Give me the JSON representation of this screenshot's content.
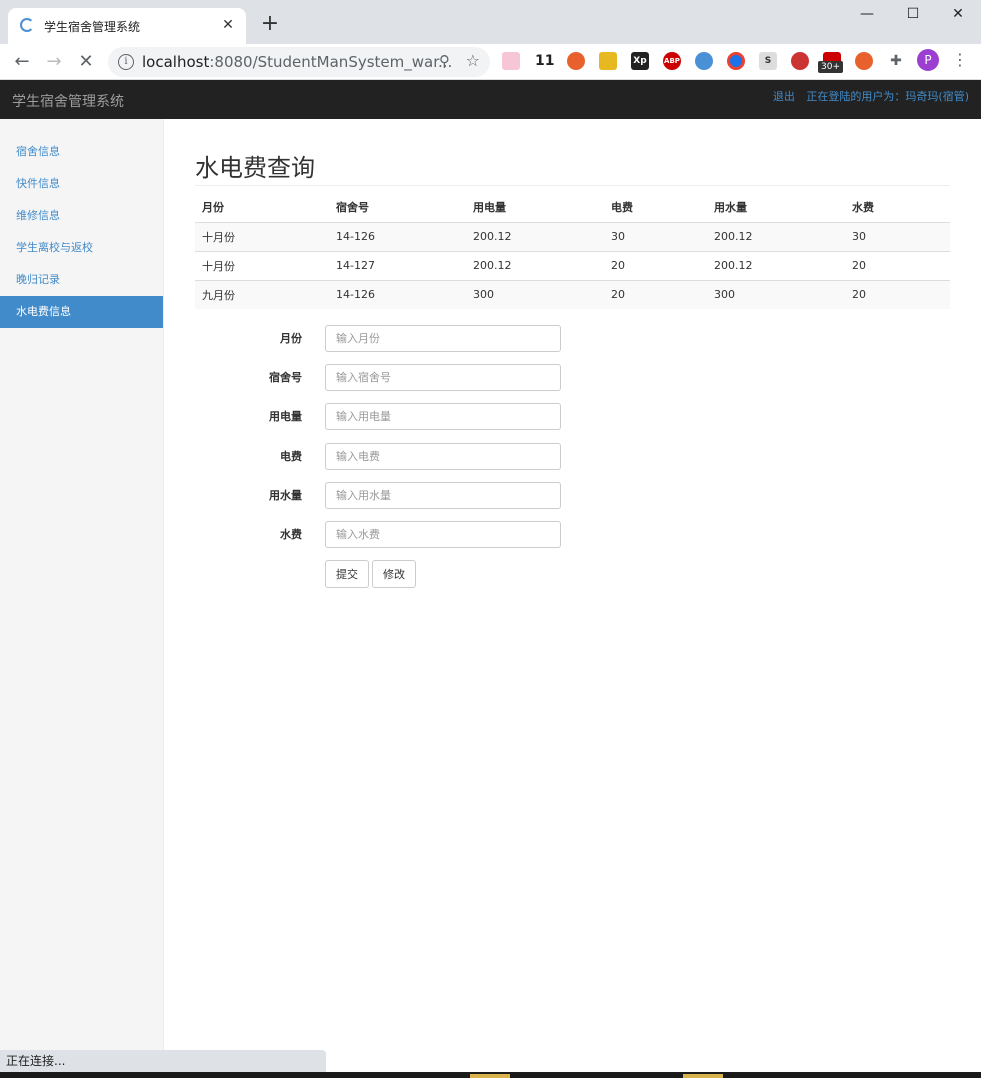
{
  "browser": {
    "tab_title": "学生宿舍管理系统",
    "tab_close": "✕",
    "new_tab": "+",
    "url_host": "localhost",
    "url_rest": ":8080/StudentManSystem_war...",
    "ext_badge_count": "30+",
    "ext_number": "11",
    "profile_initial": "P",
    "window_controls": {
      "minimize": "—",
      "maximize": "☐",
      "close": "✕"
    },
    "status_text": "正在连接..."
  },
  "navbar": {
    "brand": "学生宿舍管理系统",
    "logout": "退出",
    "current_user": "正在登陆的用户为：玛奇玛(宿管)"
  },
  "sidebar": {
    "items": [
      {
        "label": "宿舍信息"
      },
      {
        "label": "快件信息"
      },
      {
        "label": "维修信息"
      },
      {
        "label": "学生离校与返校"
      },
      {
        "label": "晚归记录"
      },
      {
        "label": "水电费信息"
      }
    ],
    "active_index": 5
  },
  "main": {
    "title": "水电费查询",
    "table": {
      "headers": [
        "月份",
        "宿舍号",
        "用电量",
        "电费",
        "用水量",
        "水费"
      ],
      "rows": [
        [
          "十月份",
          "14-126",
          "200.12",
          "30",
          "200.12",
          "30"
        ],
        [
          "十月份",
          "14-127",
          "200.12",
          "20",
          "200.12",
          "20"
        ],
        [
          "九月份",
          "14-126",
          "300",
          "20",
          "300",
          "20"
        ]
      ]
    },
    "form": {
      "fields": [
        {
          "label": "月份",
          "placeholder": "输入月份"
        },
        {
          "label": "宿舍号",
          "placeholder": "输入宿舍号"
        },
        {
          "label": "用电量",
          "placeholder": "输入用电量"
        },
        {
          "label": "电费",
          "placeholder": "输入电费"
        },
        {
          "label": "用水量",
          "placeholder": "输入用水量"
        },
        {
          "label": "水费",
          "placeholder": "输入水费"
        }
      ],
      "submit_label": "提交",
      "modify_label": "修改"
    }
  }
}
